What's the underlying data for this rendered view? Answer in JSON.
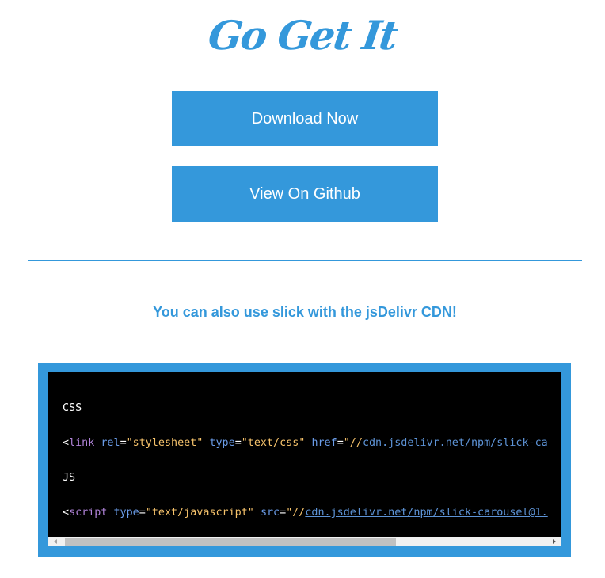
{
  "logo": {
    "text": "Go Get It"
  },
  "buttons": {
    "download": "Download Now",
    "github": "View On Github"
  },
  "cdn_note": "You can also use slick with the jsDelivr CDN!",
  "code": {
    "css_label": "CSS",
    "css_line": {
      "open": "<",
      "tag": "link",
      "rel_attr": "rel",
      "rel_value": "\"stylesheet\"",
      "type_attr": "type",
      "type_value": "\"text/css\"",
      "href_attr": "href",
      "href_prefix": "\"//",
      "href_link": "cdn.jsdelivr.net/npm/slick-ca"
    },
    "js_label": "JS",
    "js_line": {
      "open": "<",
      "tag": "script",
      "type_attr": "type",
      "type_value": "\"text/javascript\"",
      "src_attr": "src",
      "src_prefix": "\"//",
      "src_link": "cdn.jsdelivr.net/npm/slick-carousel@1."
    }
  },
  "icons": {
    "scroll_left": "triangle-left",
    "scroll_right": "triangle-right"
  },
  "colors": {
    "accent": "#3498db",
    "code_bg": "#000000",
    "tag": "#b083d8",
    "attr": "#6a9ce8",
    "string": "#f5c26b",
    "link": "#5d93d6"
  }
}
